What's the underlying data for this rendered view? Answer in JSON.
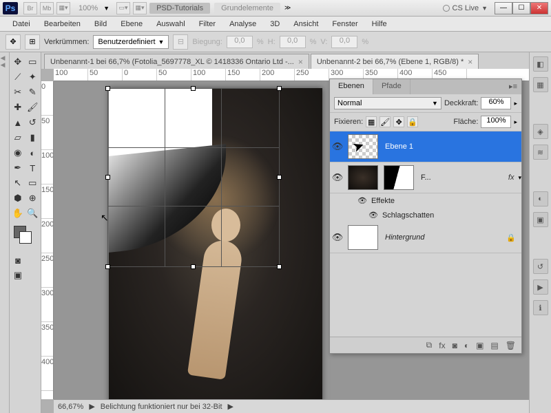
{
  "titlebar": {
    "logo": "Ps",
    "bridge": "Br",
    "minibridge": "Mb",
    "zoom": "100%",
    "label1": "PSD-Tutorials",
    "label2": "Grundelemente",
    "cslive": "CS Live"
  },
  "menu": [
    "Datei",
    "Bearbeiten",
    "Bild",
    "Ebene",
    "Auswahl",
    "Filter",
    "Analyse",
    "3D",
    "Ansicht",
    "Fenster",
    "Hilfe"
  ],
  "options": {
    "warp_label": "Verkrümmen:",
    "warp_value": "Benutzerdefiniert",
    "bend_label": "Biegung:",
    "bend_value": "0,0",
    "h_label": "H:",
    "h_value": "0,0",
    "v_label": "V:",
    "v_value": "0,0",
    "pct": "%"
  },
  "tabs": [
    "Unbenannt-1 bei 66,7% (Fotolia_5697778_XL © 1418336 Ontario Ltd -...",
    "Unbenannt-2 bei 66,7% (Ebene 1, RGB/8) *"
  ],
  "ruler_h": [
    "100",
    "50",
    "0",
    "50",
    "100",
    "150",
    "200",
    "250",
    "300",
    "350",
    "400",
    "450"
  ],
  "ruler_v": [
    "0",
    "50",
    "100",
    "150",
    "200",
    "250",
    "300",
    "350",
    "400"
  ],
  "status": {
    "zoom": "66,67%",
    "msg": "Belichtung funktioniert nur bei 32-Bit"
  },
  "panel": {
    "tabs": [
      "Ebenen",
      "Pfade"
    ],
    "blend": "Normal",
    "opacity_label": "Deckkraft:",
    "opacity": "60%",
    "lock_label": "Fixieren:",
    "fill_label": "Fläche:",
    "fill": "100%",
    "layers": [
      {
        "name": "Ebene 1"
      },
      {
        "name": "F...",
        "fx": "fx",
        "effects_label": "Effekte",
        "effect1": "Schlagschatten"
      },
      {
        "name": "Hintergrund"
      }
    ],
    "footer_fx": "fx"
  }
}
